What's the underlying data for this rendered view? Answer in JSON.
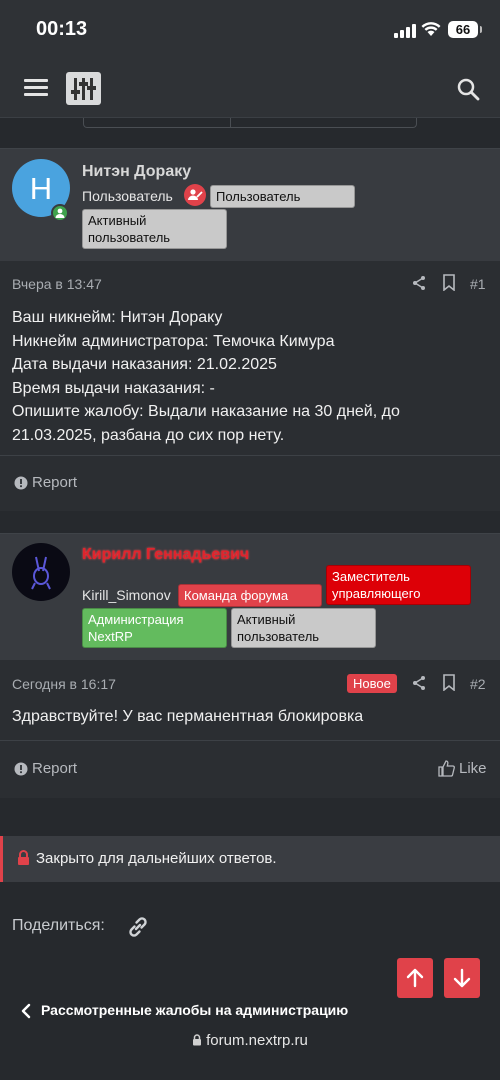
{
  "status_bar": {
    "time": "00:13",
    "battery": "66"
  },
  "colors": {
    "accent_red": "#e0424a",
    "staff_name": "#e0242d",
    "admin_green": "#63bb5e",
    "badge_gray": "#c9c9c9"
  },
  "icons": {
    "menu": "hamburger-icon",
    "logo": "sliders-logo-icon",
    "search": "search-icon",
    "share": "share-icon",
    "bookmark": "bookmark-icon",
    "report": "exclamation-circle-icon",
    "like": "thumbs-up-icon",
    "lock": "lock-icon",
    "link": "link-icon",
    "arrow_up": "arrow-up-icon",
    "arrow_down": "arrow-down-icon",
    "back": "chevron-left-icon"
  },
  "posts": [
    {
      "avatar_letter": "Н",
      "username": "Нитэн Дораку",
      "user_title": "Пользователь",
      "badges": [
        "Пользователь",
        "Активный пользователь"
      ],
      "date": "Вчера в 13:47",
      "number": "#1",
      "lines": [
        "Ваш никнейм: Нитэн Дораку",
        "Никнейм администратора: Темочка Кимура",
        "Дата выдачи наказания: 21.02.2025",
        "Время выдачи наказания: -",
        "Опишите жалобу: Выдали наказание на 30 дней, до",
        "21.03.2025, разбана до сих пор нету."
      ],
      "report_label": "Report"
    },
    {
      "username": "Кирилл Геннадьевич",
      "user_title": "Kirill_Simonov",
      "badges": [
        "Команда форума",
        "Заместитель управляющего",
        "Администрация NextRP",
        "Активный пользователь"
      ],
      "date": "Сегодня в 16:17",
      "new_label": "Новое",
      "number": "#2",
      "lines": [
        "Здравствуйте! У вас перманентная блокировка"
      ],
      "report_label": "Report",
      "like_label": "Like"
    }
  ],
  "closed_notice": "Закрыто для дальнейших ответов.",
  "share_label": "Поделиться:",
  "breadcrumb": "Рассмотренные жалобы на администрацию",
  "url": "forum.nextrp.ru"
}
